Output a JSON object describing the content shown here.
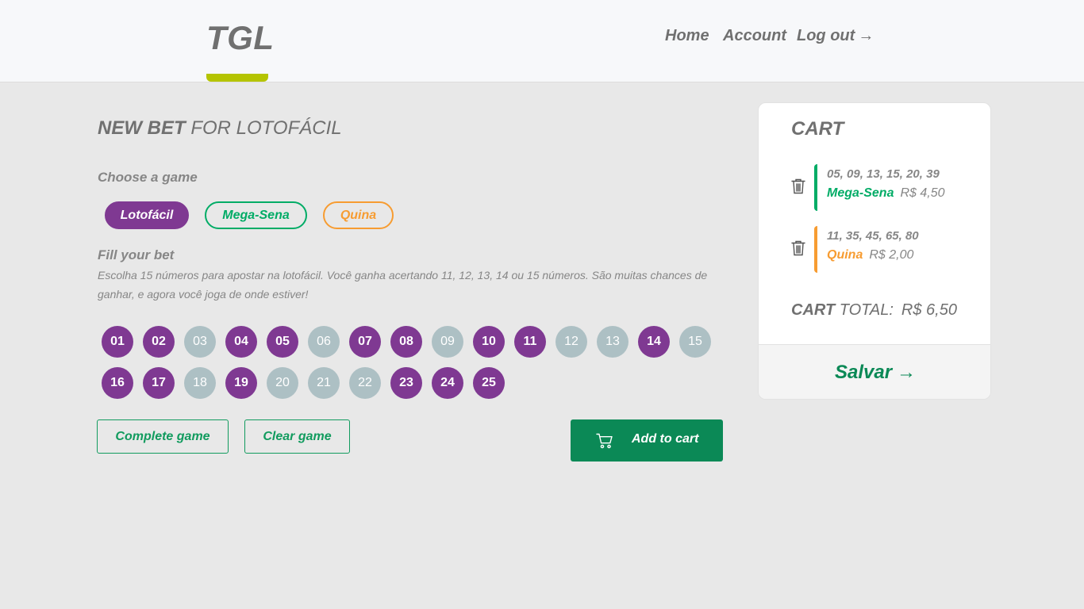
{
  "header": {
    "logo": "TGL",
    "nav": {
      "home": "Home",
      "account": "Account",
      "logout": "Log out",
      "logout_arrow": "→"
    }
  },
  "main": {
    "title_bold": "NEW BET",
    "title_rest": " FOR LOTOFÁCIL",
    "choose_label": "Choose a game",
    "games": [
      {
        "label": "Lotofácil",
        "color": "#7F3992",
        "active": true
      },
      {
        "label": "Mega-Sena",
        "color": "#01AC66",
        "active": false
      },
      {
        "label": "Quina",
        "color": "#F79C31",
        "active": false
      }
    ],
    "fill_title": "Fill your bet",
    "fill_desc": "Escolha 15 números para apostar na lotofácil. Você ganha acertando 11, 12, 13, 14 ou 15 números. São muitas chances de ganhar, e agora você joga de onde estiver!",
    "numbers": [
      {
        "n": "01",
        "selected": true
      },
      {
        "n": "02",
        "selected": true
      },
      {
        "n": "03",
        "selected": false
      },
      {
        "n": "04",
        "selected": true
      },
      {
        "n": "05",
        "selected": true
      },
      {
        "n": "06",
        "selected": false
      },
      {
        "n": "07",
        "selected": true
      },
      {
        "n": "08",
        "selected": true
      },
      {
        "n": "09",
        "selected": false
      },
      {
        "n": "10",
        "selected": true
      },
      {
        "n": "11",
        "selected": true
      },
      {
        "n": "12",
        "selected": false
      },
      {
        "n": "13",
        "selected": false
      },
      {
        "n": "14",
        "selected": true
      },
      {
        "n": "15",
        "selected": false
      },
      {
        "n": "16",
        "selected": true
      },
      {
        "n": "17",
        "selected": true
      },
      {
        "n": "18",
        "selected": false
      },
      {
        "n": "19",
        "selected": true
      },
      {
        "n": "20",
        "selected": false
      },
      {
        "n": "21",
        "selected": false
      },
      {
        "n": "22",
        "selected": false
      },
      {
        "n": "23",
        "selected": true
      },
      {
        "n": "24",
        "selected": true
      },
      {
        "n": "25",
        "selected": true
      }
    ],
    "complete_label": "Complete game",
    "clear_label": "Clear game",
    "add_to_cart_label": "Add to cart"
  },
  "cart": {
    "title": "CART",
    "items": [
      {
        "numbers": "05, 09, 13, 15, 20, 39",
        "game": "Mega-Sena",
        "price": "R$ 4,50",
        "color": "#01AC66"
      },
      {
        "numbers": "11, 35, 45, 65, 80",
        "game": "Quina",
        "price": "R$ 2,00",
        "color": "#F79C31"
      }
    ],
    "total_bold": "CART",
    "total_label": " TOTAL:",
    "total_value": "R$ 6,50",
    "save_label": "Salvar",
    "save_arrow": "→"
  }
}
